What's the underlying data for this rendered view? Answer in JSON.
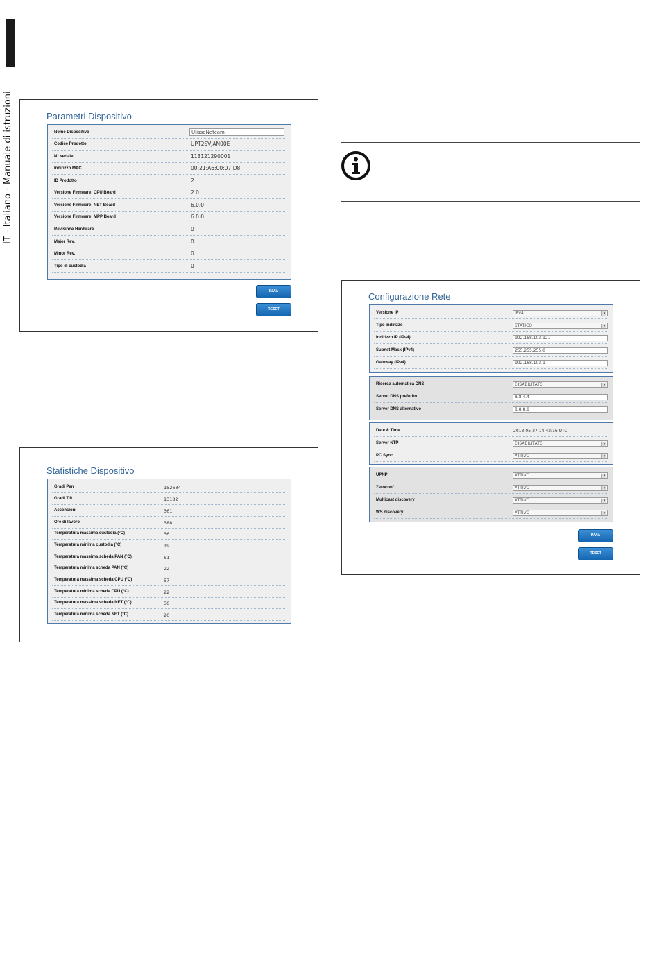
{
  "side": {
    "text": "IT - Italiano - Manuale di istruzioni"
  },
  "device_params": {
    "title": "Parametri Dispositivo",
    "rows": [
      {
        "label": "Nome Dispositivo",
        "value": "UlisseNetcam",
        "type": "input"
      },
      {
        "label": "Codice Prodotto",
        "value": "UPT2SVJAN00E"
      },
      {
        "label": "N° seriale",
        "value": "113121290001"
      },
      {
        "label": "Indirizzo MAC",
        "value": "00:21:A6:00:07:D8"
      },
      {
        "label": "ID Prodotto",
        "value": "2"
      },
      {
        "label": "Versione Firmware: CPU Board",
        "value": "2.0"
      },
      {
        "label": "Versione Firmware: NET Board",
        "value": "6.0.0"
      },
      {
        "label": "Versione Firmware: MPP Board",
        "value": "6.0.0"
      },
      {
        "label": "Revisione Hardware",
        "value": "0"
      },
      {
        "label": "Major Rev.",
        "value": "0"
      },
      {
        "label": "Minor Rev.",
        "value": "0"
      },
      {
        "label": "Tipo di custodia",
        "value": "0"
      }
    ],
    "send_label": "INVIA",
    "reset_label": "RESET"
  },
  "device_stats": {
    "title": "Statistiche Dispositivo",
    "rows": [
      {
        "label": "Gradi Pan",
        "value": "152684"
      },
      {
        "label": "Gradi Tilt",
        "value": "13182"
      },
      {
        "label": "Accensioni",
        "value": "361"
      },
      {
        "label": "Ore di lavoro",
        "value": "388"
      },
      {
        "label": "Temperatura massima custodia (°C)",
        "value": "36"
      },
      {
        "label": "Temperatura minima custodia (°C)",
        "value": "19"
      },
      {
        "label": "Temperatura massima scheda PAN (°C)",
        "value": "61"
      },
      {
        "label": "Temperatura minima scheda PAN (°C)",
        "value": "22"
      },
      {
        "label": "Temperatura massima scheda CPU (°C)",
        "value": "57"
      },
      {
        "label": "Temperatura minima scheda CPU (°C)",
        "value": "22"
      },
      {
        "label": "Temperatura massima scheda NET (°C)",
        "value": "50"
      },
      {
        "label": "Temperatura minima scheda NET (°C)",
        "value": "20"
      }
    ]
  },
  "network": {
    "title": "Configurazione Rete",
    "group1": [
      {
        "label": "Versione IP",
        "value": "IPv4",
        "type": "select"
      },
      {
        "label": "Tipo indirizzo",
        "value": "STATICO",
        "type": "select"
      },
      {
        "label": "Indirizzo IP (IPv4)",
        "value": "192.168.103.121",
        "type": "input"
      },
      {
        "label": "Subnet Mask (IPv4)",
        "value": "255.255.255.0",
        "type": "input"
      },
      {
        "label": "Gateway (IPv4)",
        "value": "192.168.103.1",
        "type": "input"
      }
    ],
    "group2": [
      {
        "label": "Ricerca automatica DNS",
        "value": "DISABILITATO",
        "type": "select"
      },
      {
        "label": "Server DNS preferito",
        "value": "8.8.4.4",
        "type": "input"
      },
      {
        "label": "Server DNS alternativo",
        "value": "8.8.8.8",
        "type": "input"
      }
    ],
    "group3": [
      {
        "label": "Date & Time",
        "value": "2013-05-27 14:42:16 UTC",
        "type": "text"
      },
      {
        "label": "Server NTP",
        "value": "DISABILITATO",
        "type": "select"
      },
      {
        "label": "PC Sync",
        "value": "ATTIVO",
        "type": "select"
      }
    ],
    "group4": [
      {
        "label": "UPNP",
        "value": "ATTIVO",
        "type": "select"
      },
      {
        "label": "Zeroconf",
        "value": "ATTIVO",
        "type": "select"
      },
      {
        "label": "Multicast discovery",
        "value": "ATTIVO",
        "type": "select"
      },
      {
        "label": "WS discovery",
        "value": "ATTIVO",
        "type": "select"
      }
    ],
    "send_label": "INVIA",
    "reset_label": "RESET"
  }
}
